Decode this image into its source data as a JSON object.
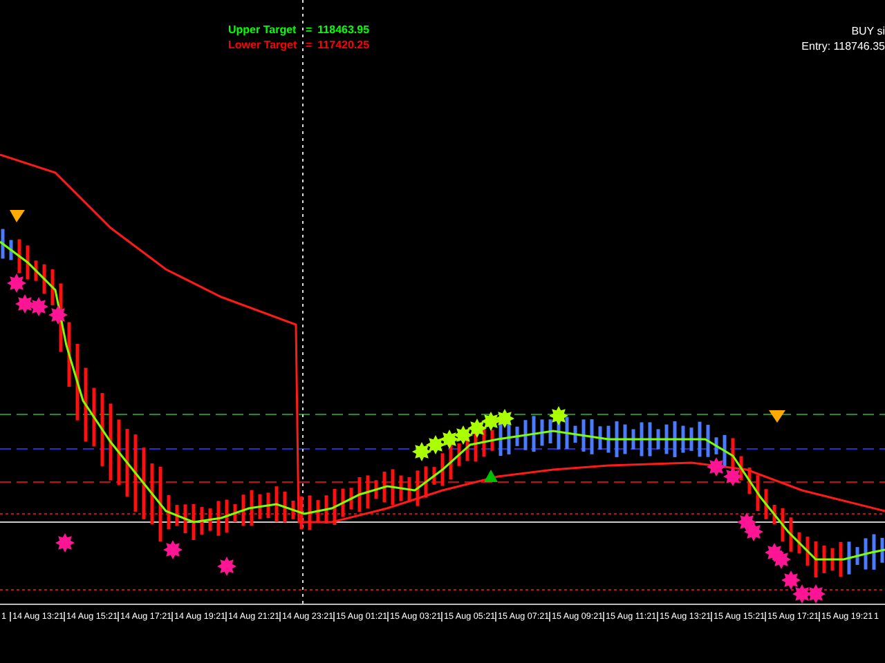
{
  "targets": [
    {
      "label": "Upper Target",
      "sign": "=",
      "value": "118463.95",
      "color": "#00ff00"
    },
    {
      "label": "Lower Target",
      "sign": "=",
      "value": "117420.25",
      "color": "#ff0000"
    }
  ],
  "signal": {
    "text": "BUY si",
    "entry": "Entry: 118746.35"
  },
  "time_axis": {
    "labels": [
      "1",
      "14 Aug 13:21",
      "14 Aug 15:21",
      "14 Aug 17:21",
      "14 Aug 19:21",
      "14 Aug 21:21",
      "14 Aug 23:21",
      "15 Aug 01:21",
      "15 Aug 03:21",
      "15 Aug 05:21",
      "15 Aug 07:21",
      "15 Aug 09:21",
      "15 Aug 11:21",
      "15 Aug 13:21",
      "15 Aug 15:21",
      "15 Aug 17:21",
      "15 Aug 19:21",
      "1"
    ]
  }
}
